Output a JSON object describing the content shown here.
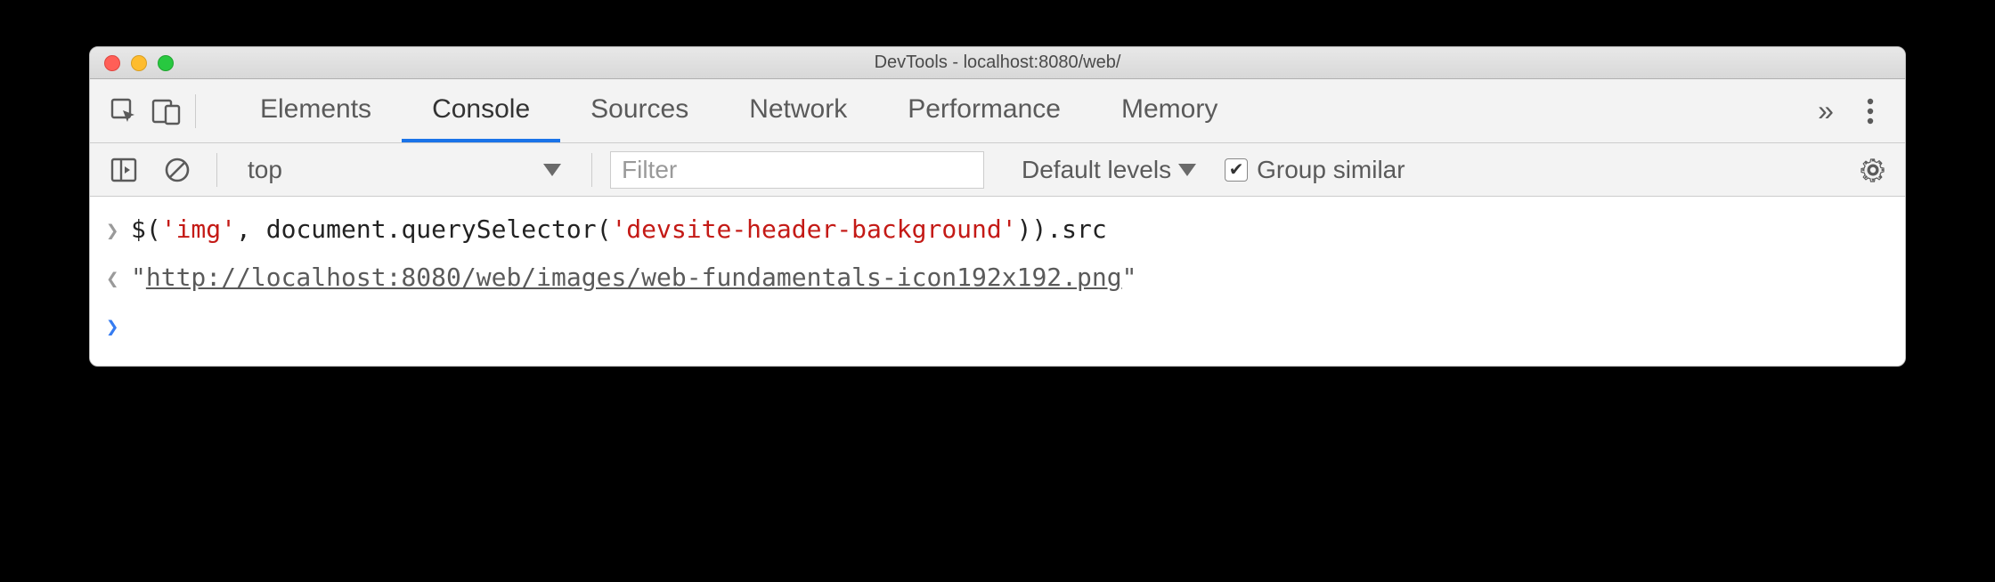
{
  "window": {
    "title": "DevTools - localhost:8080/web/"
  },
  "tabs": {
    "elements": "Elements",
    "console": "Console",
    "sources": "Sources",
    "network": "Network",
    "performance": "Performance",
    "memory": "Memory"
  },
  "toolbar": {
    "context": "top",
    "filter_placeholder": "Filter",
    "levels": "Default levels",
    "group_similar": "Group similar"
  },
  "console": {
    "input_parts": {
      "p1": "$(",
      "s1": "'img'",
      "p2": ", document.querySelector(",
      "s2": "'devsite-header-background'",
      "p3": ")).src"
    },
    "output_parts": {
      "q1": "\"",
      "url": "http://localhost:8080/web/images/web-fundamentals-icon192x192.png",
      "q2": "\""
    }
  }
}
